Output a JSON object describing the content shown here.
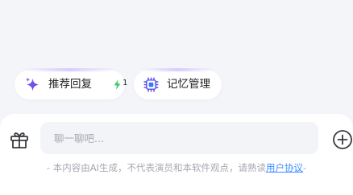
{
  "quick_actions": [
    {
      "label": "推荐回复",
      "badge_count": "1",
      "icon": "sparkle-icon"
    },
    {
      "label": "记忆管理",
      "icon": "chip-icon"
    }
  ],
  "composer": {
    "placeholder": "聊一聊吧...",
    "value": "",
    "left_icon": "gift-icon",
    "right_icon": "plus-circle-icon"
  },
  "disclaimer": {
    "prefix": "- 本内容由AI生成，不代表演员和本软件观点，请熟读",
    "link_text": "用户协议",
    "suffix": "-"
  },
  "colors": {
    "background": "#f4f5f8",
    "accent_purple": "#6a4cf5",
    "bolt_green": "#3ec96c",
    "link_blue": "#3c8dff"
  }
}
